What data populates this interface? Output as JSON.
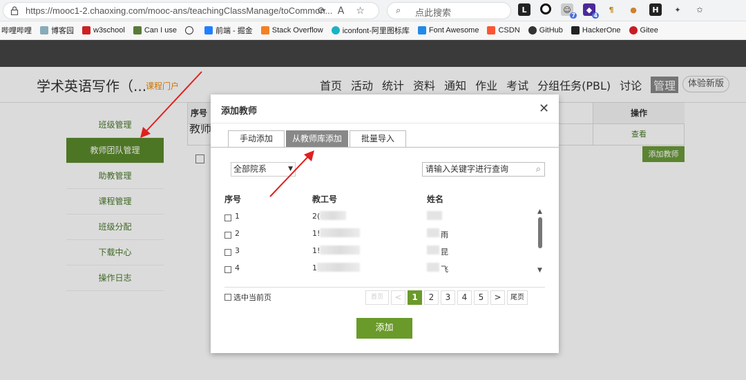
{
  "browser": {
    "url": "https://mooc1-2.chaoxing.com/mooc-ans/teachingClassManage/toCommon...",
    "search_placeholder": "点此搜索",
    "bookmarks": [
      "哔哩哔哩",
      "博客园",
      "w3school",
      "Can I use",
      "",
      "前端 - 掘金",
      "Stack Overflow",
      "iconfont-阿里图标库",
      "Font Awesome",
      "CSDN",
      "GitHub",
      "HackerOne",
      "Gitee"
    ],
    "ext_badges": {
      "e1": "7",
      "e2": "4"
    }
  },
  "page": {
    "course_title": "学术英语写作（...",
    "course_portal": "课程门户",
    "nav": [
      "首页",
      "活动",
      "统计",
      "资料",
      "通知",
      "作业",
      "考试",
      "分组任务(PBL)",
      "讨论",
      "管理"
    ],
    "try_new": "体验新版",
    "side_menu": [
      "班级管理",
      "教师团队管理",
      "助教管理",
      "课程管理",
      "班级分配",
      "下载中心",
      "操作日志"
    ],
    "teacher_heading": "教师",
    "add_teacher": "添加教师",
    "table_headers": {
      "seq": "序号",
      "op": "操作"
    },
    "view_link": "查看"
  },
  "modal": {
    "title": "添加教师",
    "close": "✕",
    "tabs": [
      "手动添加",
      "从教师库添加",
      "批量导入"
    ],
    "dept_select": "全部院系",
    "search_placeholder": "请输入关键字进行查询",
    "columns": {
      "seq": "序号",
      "id": "教工号",
      "name": "姓名"
    },
    "rows": [
      {
        "seq": "1",
        "id": "2(",
        "name": ""
      },
      {
        "seq": "2",
        "id": "1!",
        "name": "雨"
      },
      {
        "seq": "3",
        "id": "1!",
        "name": "昆"
      },
      {
        "seq": "4",
        "id": "1",
        "name": "飞"
      }
    ],
    "select_current_page": "选中当前页",
    "pager": {
      "first": "首页",
      "prev": "<",
      "pages": [
        "1",
        "2",
        "3",
        "4",
        "5"
      ],
      "next": ">",
      "last": "尾页"
    },
    "add_button": "添加"
  },
  "colors": {
    "accent_green": "#6a9a2a",
    "arrow_red": "#e0201e"
  }
}
